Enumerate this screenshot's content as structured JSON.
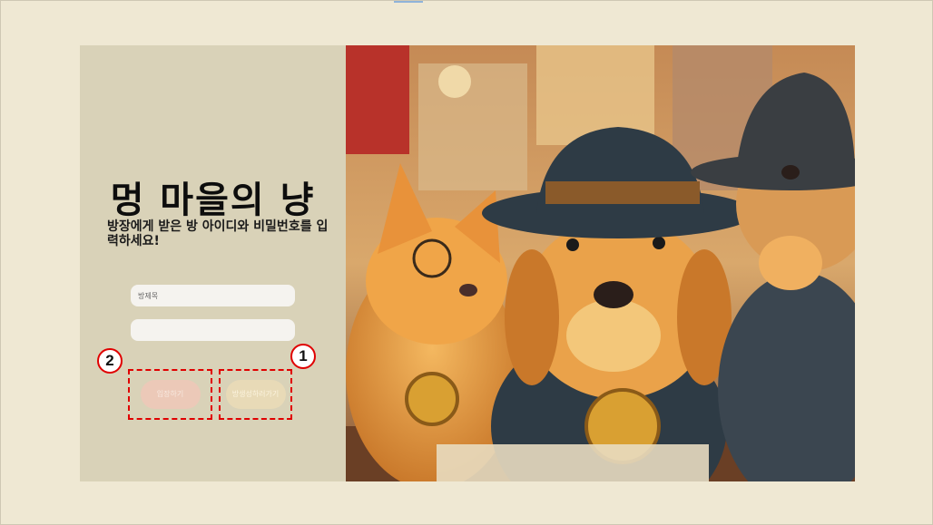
{
  "login": {
    "title": "멍 마을의 냥",
    "description": "방장에게 받은 방 아이디와 비밀번호를 입력하세요!",
    "room_name_placeholder": "방제목",
    "password_placeholder": "",
    "enter_button": "입장하기",
    "create_button": "방생성하러가기"
  },
  "annotations": {
    "badge_enter": "2",
    "badge_create": "1"
  },
  "illustration": {
    "subject": "cat-with-monocle-and-detective-dogs",
    "colors": {
      "sky": "#c9a26a",
      "hat": "#2e3b45",
      "fur": "#e59a3a",
      "coat": "#3b4650"
    }
  },
  "colors": {
    "page_bg": "#efe8d3",
    "panel_bg": "#d9d2b8",
    "annotation_red": "#e00000"
  }
}
